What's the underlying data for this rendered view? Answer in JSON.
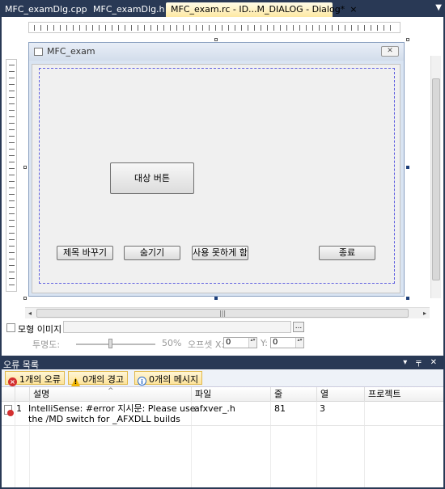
{
  "tabs": [
    {
      "label": "MFC_examDlg.cpp",
      "active": false
    },
    {
      "label": "MFC_examDlg.h",
      "active": false
    },
    {
      "label": "MFC_exam.rc - ID...M_DIALOG - Dialog*",
      "active": true
    }
  ],
  "tab_close_glyph": "×",
  "tab_dropdown_glyph": "▼",
  "dialog": {
    "title": "MFC_exam",
    "close_glyph": "✕",
    "buttons": {
      "target": "대상 버튼",
      "change_title": "제목 바꾸기",
      "hide": "숨기기",
      "disable": "사용 못하게 함",
      "exit": "종료"
    }
  },
  "hscroll": {
    "left_arrow": "◂",
    "right_arrow": "▸",
    "thumb_grip": "|||"
  },
  "props": {
    "modal_image_label": "모형 이미지",
    "browse_label": "...",
    "opacity_label": "투명도:",
    "opacity_value": "50%",
    "offset_label": "오프셋 X:",
    "offset_x": "0",
    "offset_y_label": "Y:",
    "offset_y": "0",
    "spin_glyph": "▴▾"
  },
  "error_list": {
    "title": "오류 목록",
    "title_icons": "▾ ╤ ✕",
    "filters": {
      "errors": "1개의 오류",
      "warnings": "0개의 경고",
      "messages": "0개의 메시지"
    },
    "filter_icons": {
      "error": "×",
      "warning": "!",
      "message": "i"
    },
    "columns": {
      "description": "설명",
      "file": "파일",
      "line": "줄",
      "column": "열",
      "project": "프로젝트"
    },
    "sort_glyph": "^",
    "rows": [
      {
        "index": "1",
        "description_line1": "IntelliSense: #error 지시문: Please use",
        "description_line2": "the /MD switch for _AFXDLL builds",
        "file": "afxver_.h",
        "line": "81",
        "column": "3",
        "project": ""
      }
    ]
  },
  "colors": {
    "chrome_dark": "#293955",
    "tab_active": "#fde8a3",
    "error_red": "#d32f2f",
    "warning_yellow": "#f2b705",
    "info_blue": "#2a6bc8"
  }
}
